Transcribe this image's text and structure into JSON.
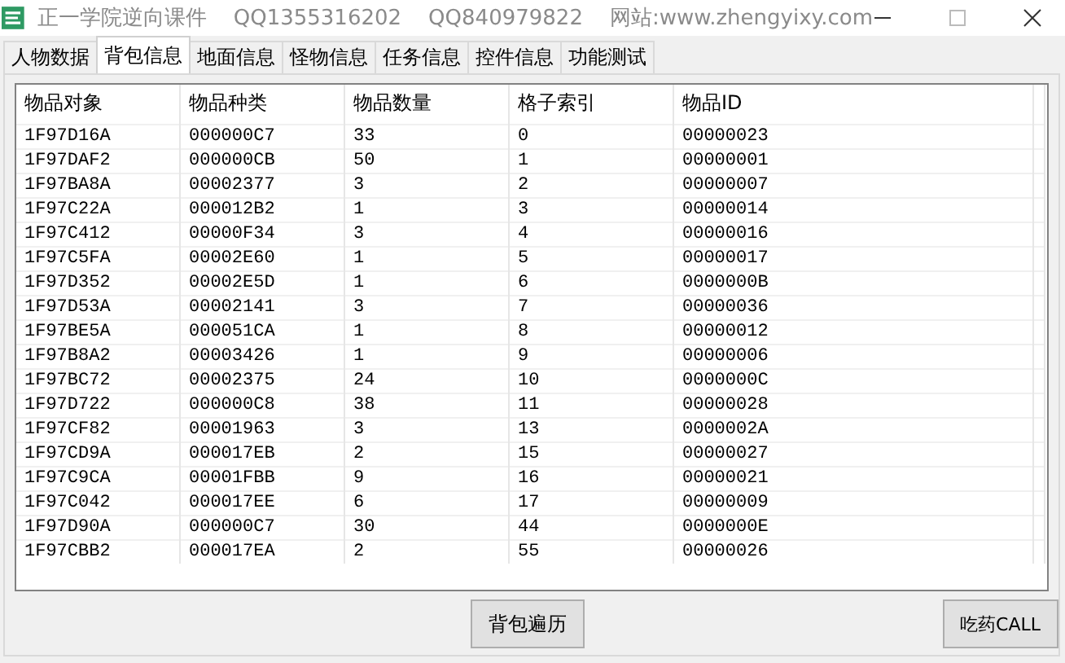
{
  "window": {
    "title": "正一学院逆向课件    QQ1355316202    QQ840979822    网站:www.zhengyixy.com"
  },
  "tabs": [
    {
      "label": "人物数据",
      "selected": false
    },
    {
      "label": "背包信息",
      "selected": true
    },
    {
      "label": "地面信息",
      "selected": false
    },
    {
      "label": "怪物信息",
      "selected": false
    },
    {
      "label": "任务信息",
      "selected": false
    },
    {
      "label": "控件信息",
      "selected": false
    },
    {
      "label": "功能测试",
      "selected": false
    }
  ],
  "table": {
    "columns": [
      "物品对象",
      "物品种类",
      "物品数量",
      "格子索引",
      "物品ID"
    ],
    "rows": [
      [
        "1F97D16A",
        "000000C7",
        "33",
        "0",
        "00000023"
      ],
      [
        "1F97DAF2",
        "000000CB",
        "50",
        "1",
        "00000001"
      ],
      [
        "1F97BA8A",
        "00002377",
        "3",
        "2",
        "00000007"
      ],
      [
        "1F97C22A",
        "000012B2",
        "1",
        "3",
        "00000014"
      ],
      [
        "1F97C412",
        "00000F34",
        "3",
        "4",
        "00000016"
      ],
      [
        "1F97C5FA",
        "00002E60",
        "1",
        "5",
        "00000017"
      ],
      [
        "1F97D352",
        "00002E5D",
        "1",
        "6",
        "0000000B"
      ],
      [
        "1F97D53A",
        "00002141",
        "3",
        "7",
        "00000036"
      ],
      [
        "1F97BE5A",
        "000051CA",
        "1",
        "8",
        "00000012"
      ],
      [
        "1F97B8A2",
        "00003426",
        "1",
        "9",
        "00000006"
      ],
      [
        "1F97BC72",
        "00002375",
        "24",
        "10",
        "0000000C"
      ],
      [
        "1F97D722",
        "000000C8",
        "38",
        "11",
        "00000028"
      ],
      [
        "1F97CF82",
        "00001963",
        "3",
        "13",
        "0000002A"
      ],
      [
        "1F97CD9A",
        "000017EB",
        "2",
        "15",
        "00000027"
      ],
      [
        "1F97C9CA",
        "00001FBB",
        "9",
        "16",
        "00000021"
      ],
      [
        "1F97C042",
        "000017EE",
        "6",
        "17",
        "00000009"
      ],
      [
        "1F97D90A",
        "000000C7",
        "30",
        "44",
        "0000000E"
      ],
      [
        "1F97CBB2",
        "000017EA",
        "2",
        "55",
        "00000026"
      ]
    ]
  },
  "buttons": [
    "背包遍历",
    "吃药CALL"
  ]
}
